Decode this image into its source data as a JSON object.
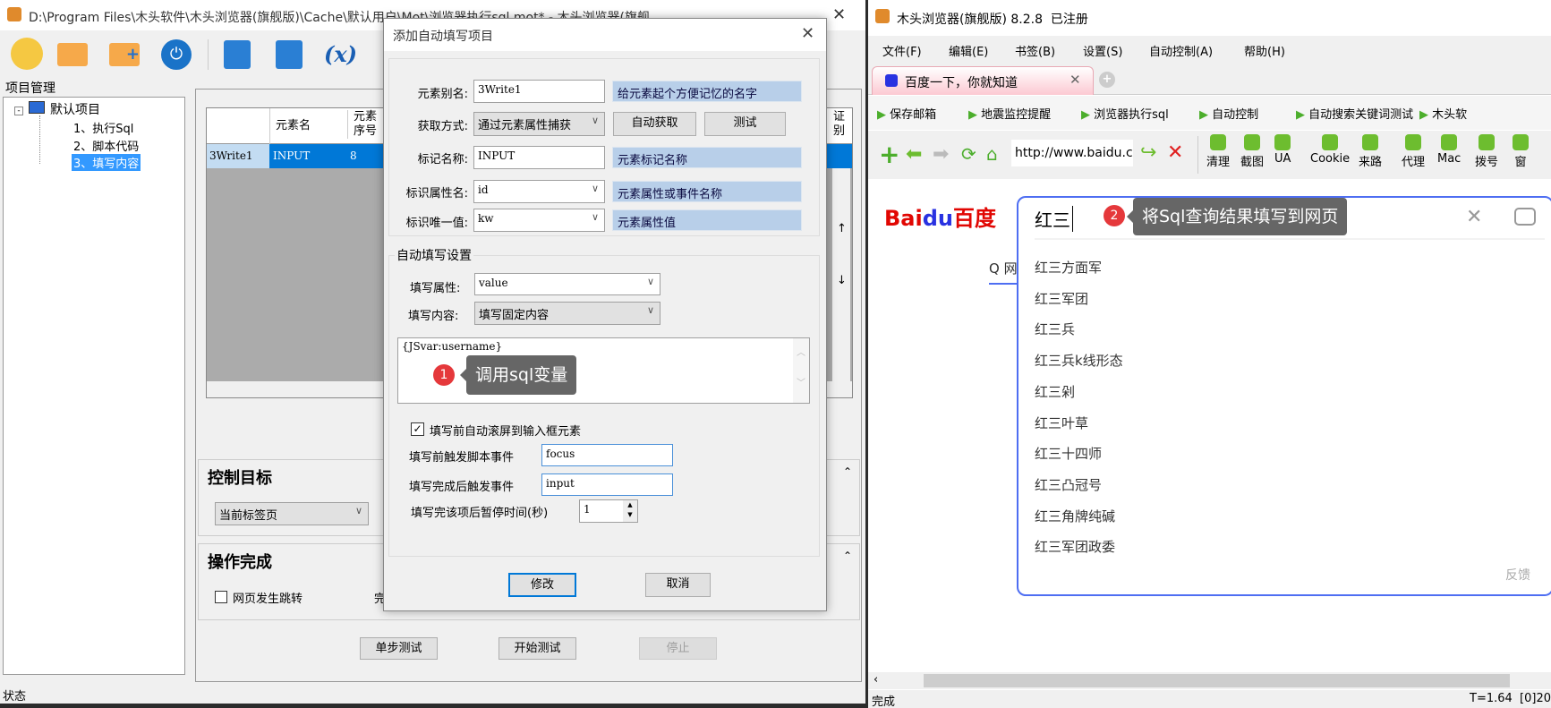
{
  "left_window": {
    "title": "D:\\Program Files\\木头软件\\木头浏览器(旗舰版)\\Cache\\默认用户\\Mot\\浏览器执行sql.mot* - 木头浏览器(旗舰",
    "toolbar_icons": [
      "new-file-icon",
      "open-folder-icon",
      "add-folder-icon",
      "power-icon",
      "save-icon",
      "save-as-icon",
      "variable-icon"
    ],
    "variable_label": "(x)",
    "project_panel_title": "项目管理",
    "tree": {
      "root": "默认项目",
      "items": [
        "1、执行Sql",
        "2、脚本代码",
        "3、填写内容"
      ]
    },
    "table": {
      "headers": [
        "",
        "元素名",
        "元素\n序号",
        "证\n别"
      ],
      "row": [
        "3Write1",
        "INPUT",
        "8"
      ]
    },
    "control_target": {
      "title": "控制目标",
      "select": "当前标签页"
    },
    "operation_done": {
      "title": "操作完成",
      "checkbox": "网页发生跳转",
      "checked": false,
      "partial": "完"
    },
    "buttons": {
      "step": "单步测试",
      "start": "开始测试",
      "stop": "停止"
    },
    "status": "状态"
  },
  "dialog": {
    "title": "添加自动填写项目",
    "fields": [
      {
        "label": "元素别名:",
        "value": "3Write1",
        "hint": "给元素起个方便记忆的名字"
      },
      {
        "label": "获取方式:",
        "value": "通过元素属性捕获",
        "btn1": "自动获取",
        "btn2": "测试"
      },
      {
        "label": "标记名称:",
        "value": "INPUT",
        "hint": "元素标记名称"
      },
      {
        "label": "标识属性名:",
        "value": "id",
        "hint": "元素属性或事件名称"
      },
      {
        "label": "标识唯一值:",
        "value": "kw",
        "hint": "元素属性值"
      }
    ],
    "fill_group": "自动填写设置",
    "fill_attr_label": "填写属性:",
    "fill_attr": "value",
    "fill_content_label": "填写内容:",
    "fill_content": "填写固定内容",
    "content_text": "{JSvar:username}",
    "autoscroll_label": "填写前自动滚屏到输入框元素",
    "autoscroll": true,
    "before_event_label": "填写前触发脚本事件",
    "before_event": "focus",
    "after_event_label": "填写完成后触发事件",
    "after_event": "input",
    "pause_label": "填写完该项后暂停时间(秒)",
    "pause": "1",
    "ok": "修改",
    "cancel": "取消",
    "annotation": {
      "num": "1",
      "text": "调用sql变量"
    }
  },
  "browser": {
    "title": "木头浏览器(旗舰版) 8.2.8  已注册",
    "menu": [
      "文件(F)",
      "编辑(E)",
      "书签(B)",
      "设置(S)",
      "自动控制(A)",
      "帮助(H)"
    ],
    "tab": "百度一下，你就知道",
    "bookmarks": [
      "保存邮箱",
      "地震监控提醒",
      "浏览器执行sql",
      "自动控制",
      "自动搜索关键词测试",
      "木头软"
    ],
    "url": "http://www.baidu.c",
    "tools": [
      "清理",
      "截图",
      "UA",
      "Cookie",
      "来路",
      "代理",
      "Mac",
      "拨号",
      "窗"
    ],
    "logo": "Bai du 百度",
    "search_text": "红三",
    "tab_fragment": "Q 网",
    "suggestions": [
      "红三方面军",
      "红三军团",
      "红三兵",
      "红三兵k线形态",
      "红三剁",
      "红三叶草",
      "红三十四师",
      "红三凸冠号",
      "红三角牌纯碱",
      "红三军团政委"
    ],
    "feedback": "反馈",
    "annotation": {
      "num": "2",
      "text": "将Sql查询结果填写到网页"
    },
    "status": "完成",
    "status_right": "T=1.64  [0]20",
    "accent": "#4e6ef2"
  }
}
